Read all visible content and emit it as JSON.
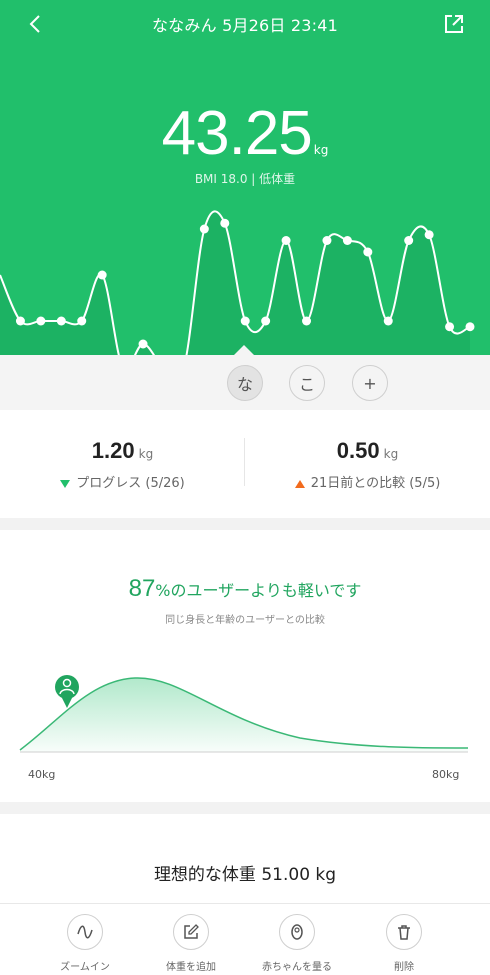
{
  "header": {
    "title": "ななみん 5月26日 23:41",
    "weight_value": "43.25",
    "weight_unit": "kg",
    "bmi_text": "BMI 18.0 | 低体重"
  },
  "trend": {
    "values": [
      0.0,
      -0.4,
      -0.4,
      -0.4,
      -0.4,
      0.0,
      -0.8,
      -0.6,
      -0.8,
      -0.8,
      0.4,
      0.45,
      -0.4,
      -0.4,
      0.3,
      -0.4,
      0.3,
      0.3,
      0.2,
      -0.4,
      0.3,
      0.35,
      -0.45,
      -0.45
    ]
  },
  "selector": {
    "chips": [
      "な",
      "こ",
      "+"
    ]
  },
  "stats": {
    "progress": {
      "value": "1.20",
      "unit": "kg",
      "label": "プログレス (5/26)"
    },
    "compare": {
      "value": "0.50",
      "unit": "kg",
      "label": "21日前との比較 (5/5)"
    }
  },
  "comparison": {
    "percent": "87",
    "percent_suffix": "%のユーザーよりも軽いです",
    "subtitle": "同じ身長と年齢のユーザーとの比較",
    "x_min_label": "40kg",
    "x_max_label": "80kg"
  },
  "ideal": {
    "text": "理想的な体重 51.00 kg"
  },
  "toolbar": {
    "items": [
      {
        "label": "ズームイン",
        "icon": "wave-icon"
      },
      {
        "label": "体重を追加",
        "icon": "edit-icon"
      },
      {
        "label": "赤ちゃんを量る",
        "icon": "baby-icon"
      },
      {
        "label": "削除",
        "icon": "trash-icon"
      }
    ]
  },
  "colors": {
    "accent": "#21bf6b",
    "down": "#21bf6b",
    "up": "#f26b1d"
  }
}
